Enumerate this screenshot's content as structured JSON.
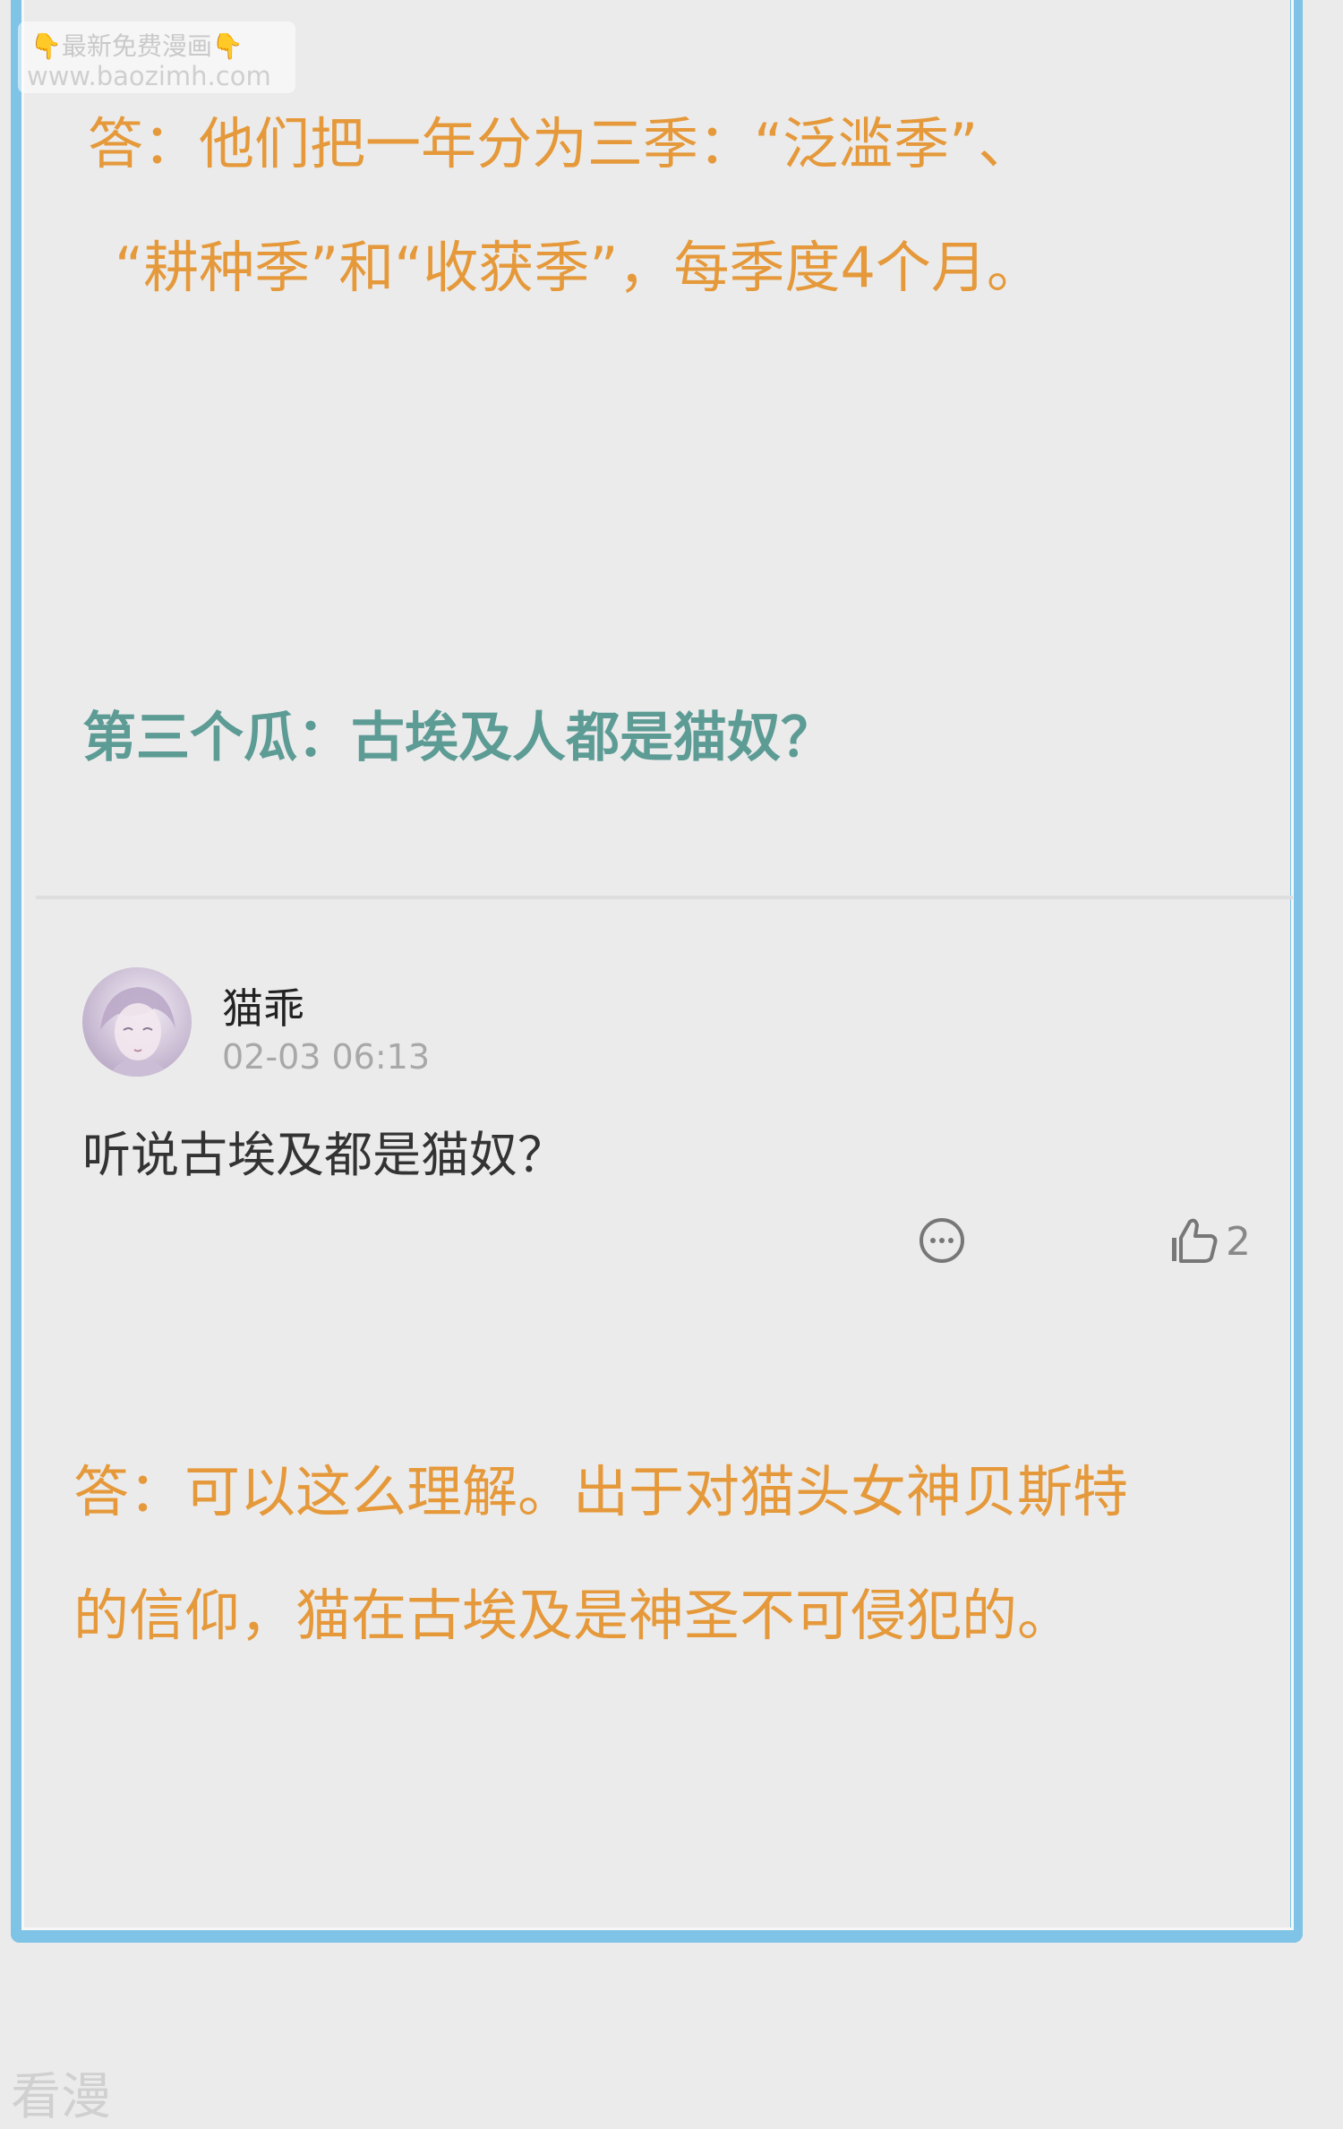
{
  "watermark": {
    "line1": "最新免费漫画",
    "hand": "👇",
    "line2": "www.baozimh.com",
    "bottom": "看漫"
  },
  "answer1": {
    "line1": "答：他们把一年分为三季：“泛滥季”、",
    "line2": "“耕种季”和“收获季”，每季度4个月。"
  },
  "question": {
    "text": "第三个瓜：古埃及人都是猫奴？"
  },
  "comment": {
    "username": "猫乖",
    "timestamp": "02-03 06:13",
    "text": "听说古埃及都是猫奴？",
    "like_count": "2",
    "reply_icon": "comment-bubble-icon",
    "like_icon": "thumbs-up-icon"
  },
  "answer2": {
    "line1": "答：可以这么理解。出于对猫头女神贝斯特",
    "line2": "的信仰，猫在古埃及是神圣不可侵犯的。"
  },
  "colors": {
    "frame_border": "#7fc3e6",
    "answer_text": "#e5993a",
    "question_text": "#5d9b95",
    "background": "#ebebeb"
  }
}
